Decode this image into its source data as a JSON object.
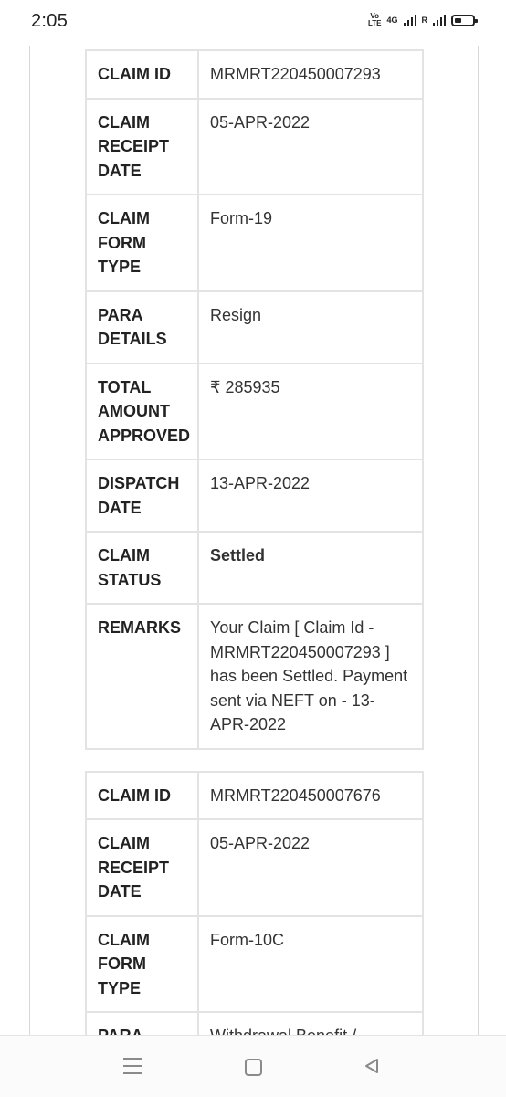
{
  "status_bar": {
    "time": "2:05",
    "volte_top": "Vo",
    "volte_bottom": "LTE",
    "network": "4G",
    "roaming": "R",
    "icons": [
      "volte-icon",
      "signal-4g-icon",
      "signal-roaming-icon",
      "battery-icon"
    ]
  },
  "claims": [
    {
      "rows": [
        {
          "label": "CLAIM ID",
          "value": "MRMRT220450007293"
        },
        {
          "label": "CLAIM RECEIPT DATE",
          "value": "05-APR-2022"
        },
        {
          "label": "CLAIM FORM TYPE",
          "value": "Form-19"
        },
        {
          "label": "PARA DETAILS",
          "value": "Resign"
        },
        {
          "label": "TOTAL AMOUNT APPROVED",
          "value": "₹ 285935"
        },
        {
          "label": "DISPATCH DATE",
          "value": "13-APR-2022"
        },
        {
          "label": "CLAIM STATUS",
          "value": "Settled"
        },
        {
          "label": "REMARKS",
          "value": "Your Claim [ Claim Id - MRMRT220450007293 ] has been Settled. Payment sent via NEFT on - 13-APR-2022"
        }
      ]
    },
    {
      "rows": [
        {
          "label": "CLAIM ID",
          "value": "MRMRT220450007676"
        },
        {
          "label": "CLAIM RECEIPT DATE",
          "value": "05-APR-2022"
        },
        {
          "label": "CLAIM FORM TYPE",
          "value": "Form-10C"
        },
        {
          "label": "PARA DETAILS",
          "value": "Withdrawal Benefit /"
        }
      ]
    }
  ],
  "nav_bar": {
    "icons": [
      "menu-icon",
      "home-icon",
      "back-icon"
    ]
  }
}
